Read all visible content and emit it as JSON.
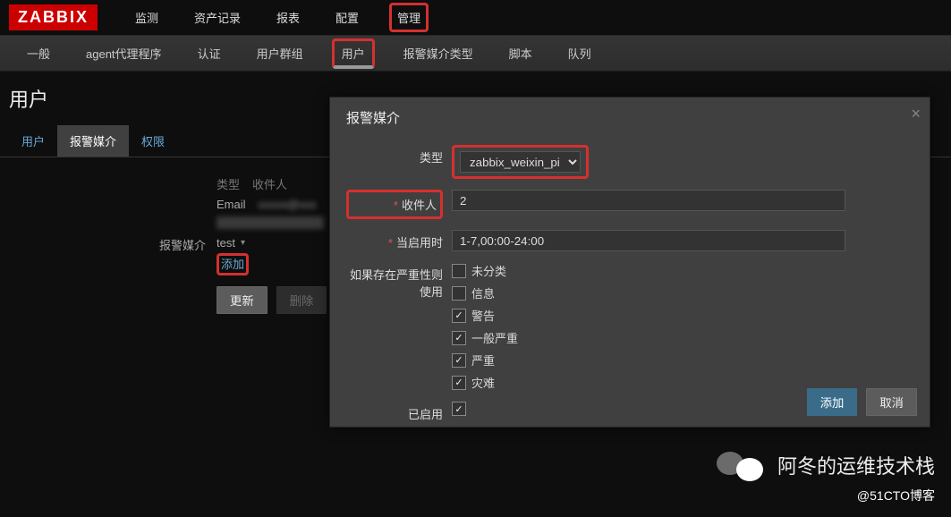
{
  "logo": "ZABBIX",
  "topnav": {
    "items": [
      "监测",
      "资产记录",
      "报表",
      "配置",
      "管理"
    ],
    "highlighted": "管理"
  },
  "subnav": {
    "items": [
      "一般",
      "agent代理程序",
      "认证",
      "用户群组",
      "用户",
      "报警媒介类型",
      "脚本",
      "队列"
    ],
    "highlighted": "用户",
    "active": "用户"
  },
  "pageTitle": "用户",
  "tabs": {
    "items": [
      "用户",
      "报警媒介",
      "权限"
    ],
    "active": "报警媒介"
  },
  "mediaSection": {
    "label": "报警媒介",
    "cols": [
      "类型",
      "收件人"
    ],
    "rows": [
      {
        "type": "Email",
        "recipient": "xxxxx@xxx"
      },
      {
        "type": "",
        "recipient": ""
      },
      {
        "type": "test",
        "recipient": ""
      }
    ],
    "addLink": "添加",
    "updateBtn": "更新",
    "deleteBtn": "删除"
  },
  "modal": {
    "title": "报警媒介",
    "typeLabel": "类型",
    "typeValue": "zabbix_weixin_pic",
    "recipientLabel": "收件人",
    "recipientValue": "2",
    "whenActiveLabel": "当启用时",
    "whenActiveValue": "1-7,00:00-24:00",
    "severityLabel": "如果存在严重性则使用",
    "severities": [
      {
        "label": "未分类",
        "checked": false
      },
      {
        "label": "信息",
        "checked": false
      },
      {
        "label": "警告",
        "checked": true
      },
      {
        "label": "一般严重",
        "checked": true
      },
      {
        "label": "严重",
        "checked": true
      },
      {
        "label": "灾难",
        "checked": true
      }
    ],
    "enabledLabel": "已启用",
    "enabledChecked": true,
    "addBtn": "添加",
    "cancelBtn": "取消"
  },
  "footer": {
    "brand": "阿冬的运维技术栈",
    "credit": "@51CTO博客"
  }
}
